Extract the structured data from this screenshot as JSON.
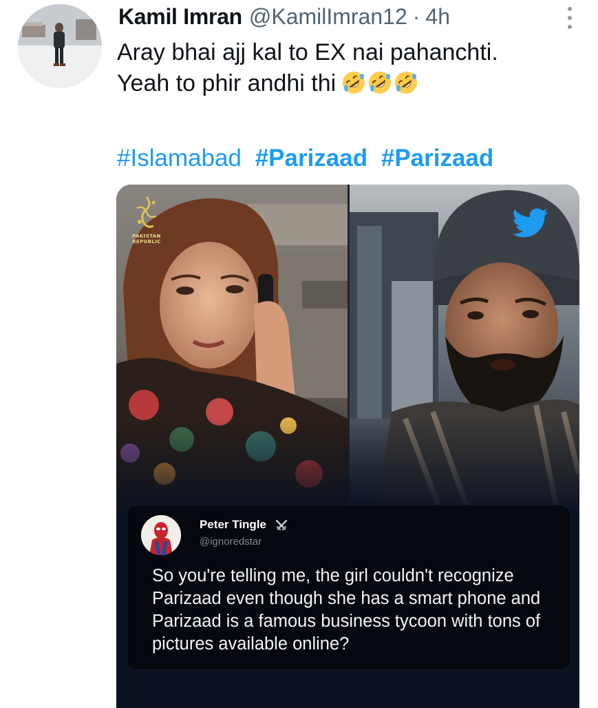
{
  "tweet": {
    "author": {
      "display_name": "Kamil Imran",
      "handle": "@KamilImran12"
    },
    "separator": "·",
    "timestamp": "4h",
    "text_lines": [
      "Aray bhai ajj kal to EX nai pahanchti.",
      "Yeah to phir andhi thi"
    ],
    "emojis": [
      "rolling-on-floor-laughing",
      "rolling-on-floor-laughing",
      "rolling-on-floor-laughing"
    ],
    "hashtags": [
      {
        "text": "#Islamabad",
        "bold": false
      },
      {
        "text": "#Parizaad",
        "bold": true
      },
      {
        "text": "#Parizaad",
        "bold": true
      }
    ]
  },
  "media": {
    "watermark": {
      "logo_text": "PAKISTAN REPUBLIC"
    },
    "overlay_icon": "twitter-bird-icon",
    "quoted_tweet": {
      "name": "Peter Tingle",
      "name_icon": "crossed-swords-icon",
      "handle": "@ignoredstar",
      "text": "So you're telling me, the girl couldn't recognize Parizaad even though she has a smart phone and Parizaad is a famous business tycoon with tons of pictures available online?"
    }
  },
  "colors": {
    "link": "#1d9bf0",
    "secondary_text": "#536471",
    "quote_card_bg": "#05080f"
  }
}
